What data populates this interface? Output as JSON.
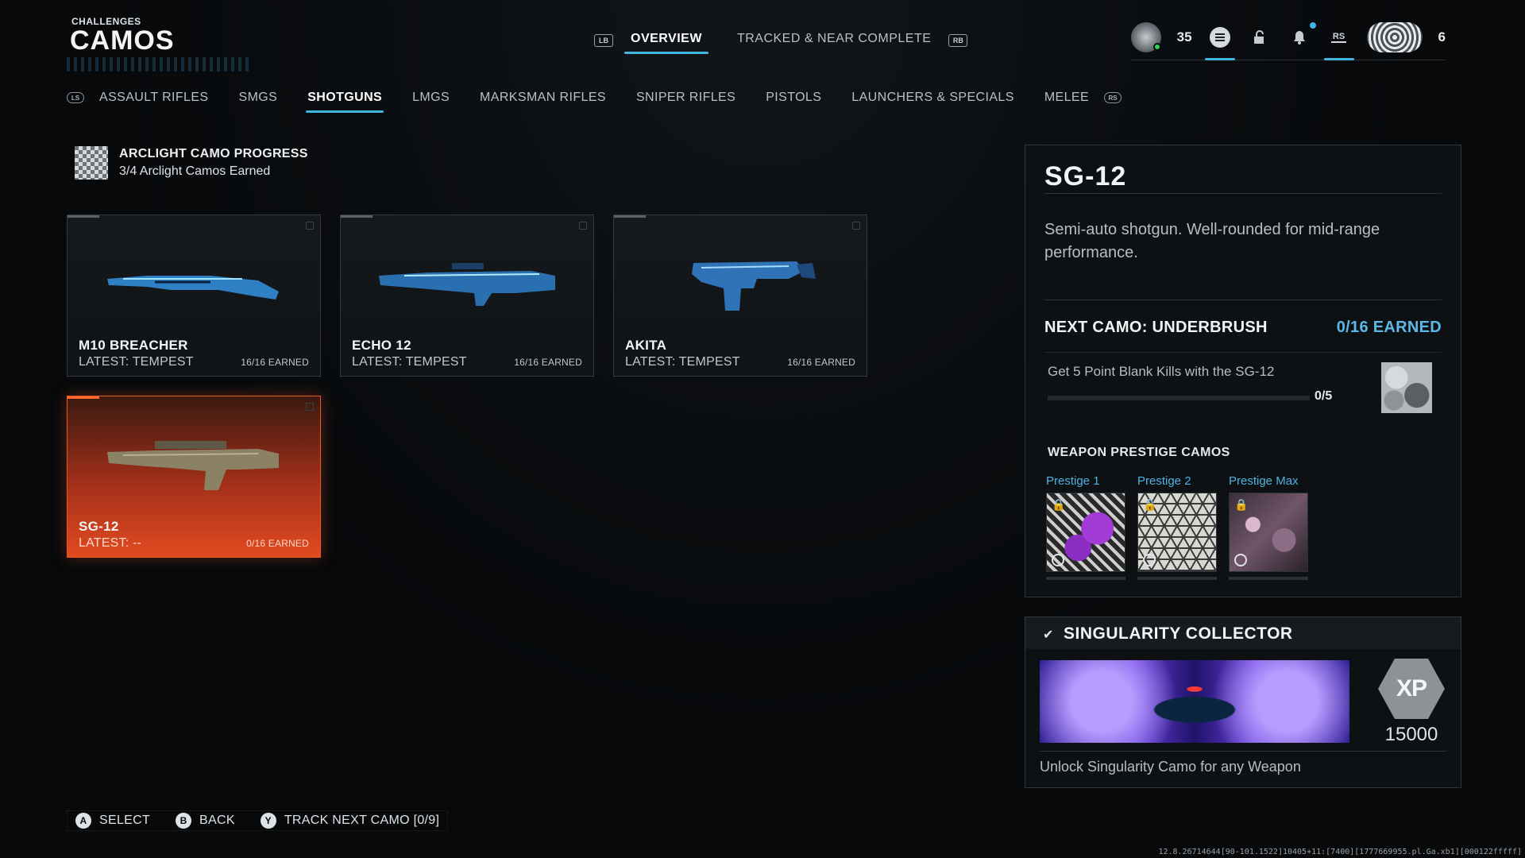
{
  "header": {
    "subtitle": "CHALLENGES",
    "title": "CAMOS"
  },
  "top_tabs": {
    "left_button": "LB",
    "right_button": "RB",
    "items": [
      {
        "label": "OVERVIEW",
        "active": true
      },
      {
        "label": "TRACKED & NEAR COMPLETE",
        "active": false
      }
    ]
  },
  "status": {
    "level": "35",
    "rs_label": "RS",
    "party_count": "6"
  },
  "categories": {
    "items": [
      {
        "label": "ASSAULT RIFLES"
      },
      {
        "label": "SMGS"
      },
      {
        "label": "SHOTGUNS",
        "active": true
      },
      {
        "label": "LMGS"
      },
      {
        "label": "MARKSMAN RIFLES"
      },
      {
        "label": "SNIPER RIFLES"
      },
      {
        "label": "PISTOLS"
      },
      {
        "label": "LAUNCHERS & SPECIALS"
      },
      {
        "label": "MELEE"
      }
    ]
  },
  "arclight": {
    "title": "ARCLIGHT CAMO PROGRESS",
    "subtitle": "3/4 Arclight Camos Earned"
  },
  "weapons": [
    {
      "name": "M10 BREACHER",
      "latest": "LATEST: TEMPEST",
      "earned": "16/16 EARNED"
    },
    {
      "name": "ECHO 12",
      "latest": "LATEST: TEMPEST",
      "earned": "16/16 EARNED"
    },
    {
      "name": "AKITA",
      "latest": "LATEST: TEMPEST",
      "earned": "16/16 EARNED"
    },
    {
      "name": "SG-12",
      "latest": "LATEST: --",
      "earned": "0/16 EARNED",
      "selected": true
    }
  ],
  "detail": {
    "title": "SG-12",
    "description": "Semi-auto shotgun. Well-rounded for mid-range performance.",
    "next_camo": "NEXT CAMO: UNDERBRUSH",
    "next_earned": "0/16 EARNED",
    "challenge": "Get 5 Point Blank Kills with the SG-12",
    "challenge_progress": 0,
    "challenge_count": "0/5",
    "prestige_heading": "WEAPON PRESTIGE CAMOS",
    "prestige": [
      {
        "label": "Prestige 1"
      },
      {
        "label": "Prestige 2"
      },
      {
        "label": "Prestige Max"
      }
    ]
  },
  "singularity": {
    "title": "SINGULARITY COLLECTOR",
    "badge": "XP",
    "xp": "15000",
    "description": "Unlock Singularity Camo for any Weapon"
  },
  "footer": {
    "hints": [
      {
        "button": "A",
        "label": "SELECT"
      },
      {
        "button": "B",
        "label": "BACK"
      },
      {
        "button": "Y",
        "label": "TRACK NEXT CAMO [0/9]"
      }
    ],
    "build": "12.8.26714644[90-101.1522]10405+11:[7400][1777669955.pl.Ga.xb1][000122fffff]"
  },
  "colors": {
    "accent": "#3fb6e0",
    "selected_card": "#e24a20",
    "earned_blue": "#5db8e8"
  }
}
